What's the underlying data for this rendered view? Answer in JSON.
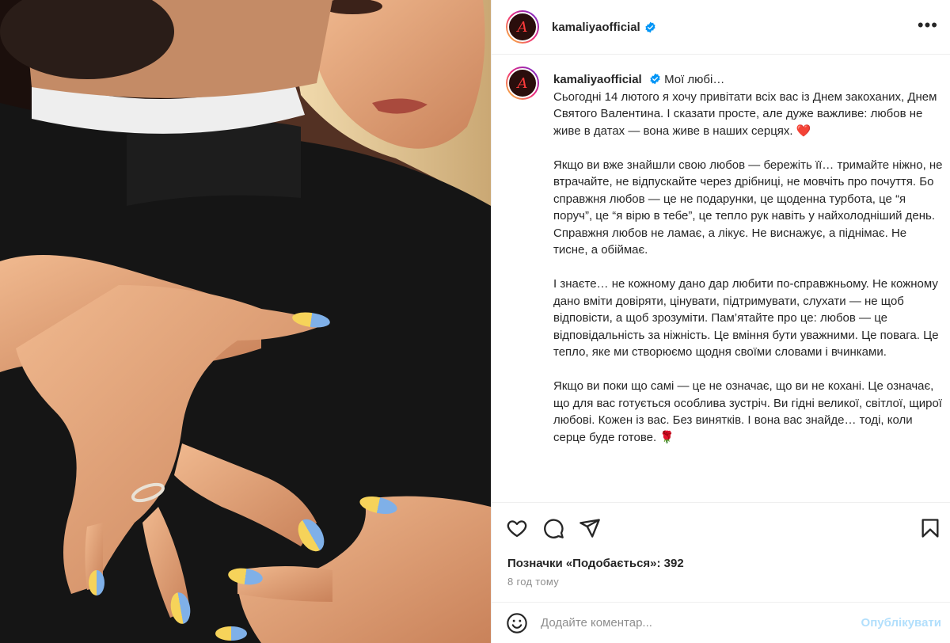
{
  "post": {
    "photo_alt": "couple-embrace-photo",
    "username": "kamaliyaofficial",
    "verified": true,
    "avatar_letter": "A",
    "more_label": "•••"
  },
  "caption": {
    "username": "kamaliyaofficial",
    "lead": "Мої любі…",
    "paragraphs": [
      "Сьогодні 14 лютого я хочу привітати всіх вас із Днем закоханих, Днем Святого Валентина. І сказати просте, але дуже важливе: любов не живе в датах — вона живе в наших серцях.",
      "Якщо ви вже знайшли свою любов — бережіть її… тримайте ніжно, не втрачайте, не відпускайте через дрібниці, не мовчіть про почуття. Бо справжня любов — це не подарунки, це щоденна турбота, це “я поруч”, це “я вірю в тебе”, це тепло рук навіть у найхолодніший день. Справжня любов не ламає, а лікує. Не виснажує, а піднімає. Не тисне, а обіймає.",
      "І знаєте… не кожному дано дар любити по-справжньому. Не кожному дано вміти довіряти, цінувати, підтримувати, слухати — не щоб відповісти, а щоб зрозуміти. Пам’ятайте про це: любов — це відповідальність за ніжність. Це вміння бути уважними. Це повага. Це тепло, яке ми створюємо щодня своїми словами і вчинками.",
      "Якщо ви поки що самі — це не означає, що ви не кохані. Це означає, що для вас готується особлива зустріч. Ви гідні великої, світлої, щирої любові. Кожен із вас. Без винятків. І вона вас знайде… тоді, коли серце буде готове."
    ],
    "emoji_end_p1": "❤️",
    "emoji_end_p4": "🌹"
  },
  "actions": {
    "likes_label": "Позначки «Подобається»: 392",
    "time_ago": "8 год тому"
  },
  "comment": {
    "placeholder": "Додайте коментар...",
    "publish_label": "Опублікувати"
  },
  "colors": {
    "verified_blue": "#0095f6",
    "publish_disabled": "#b2dffc",
    "muted_text": "#8e8e8e"
  }
}
